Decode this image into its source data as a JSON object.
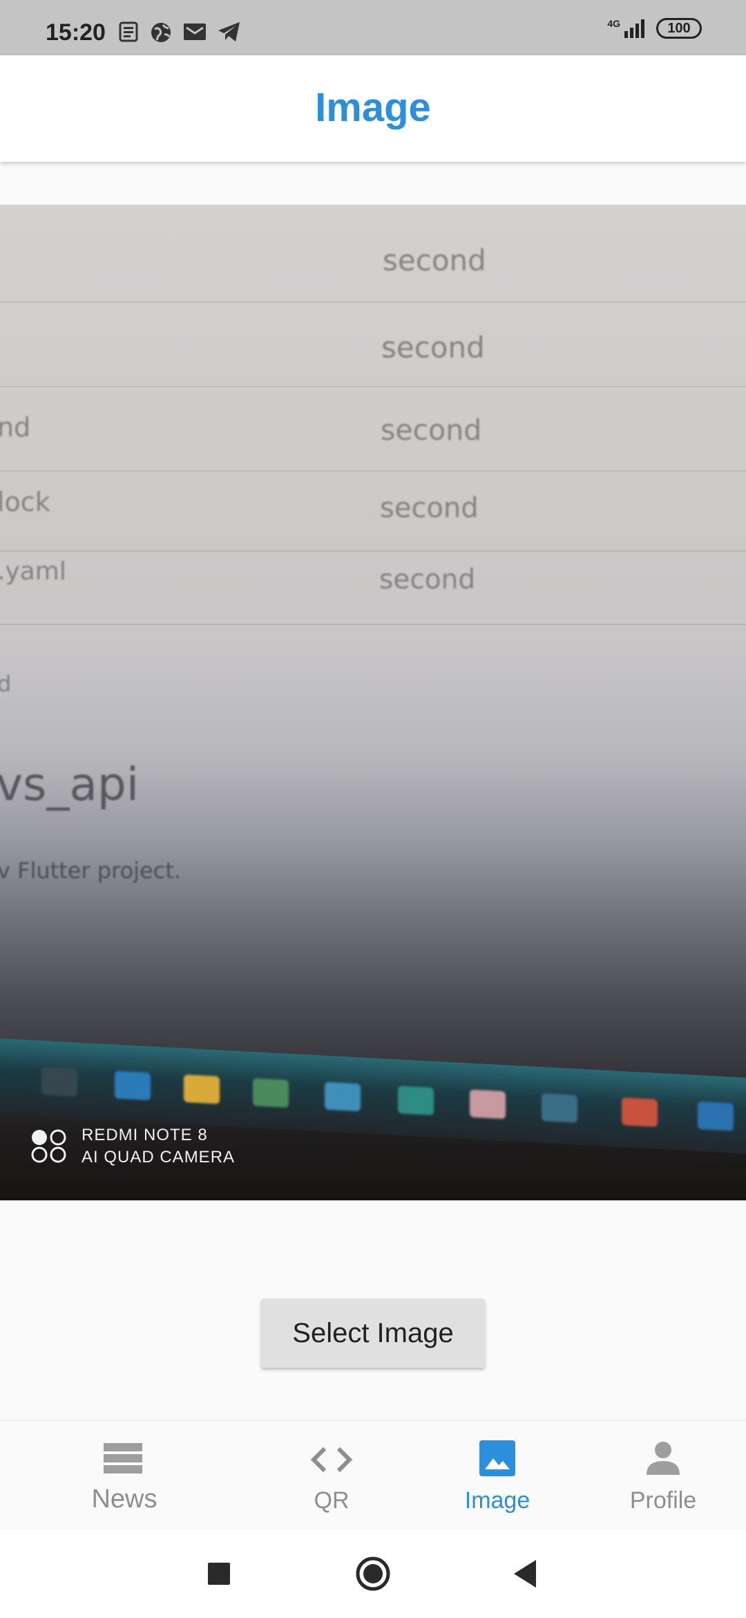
{
  "status_bar": {
    "time": "15:20",
    "network": "4G",
    "battery": "100",
    "notification_icons": [
      "news-icon",
      "globe-icon",
      "mail-icon",
      "telegram-icon"
    ]
  },
  "app_bar": {
    "title": "Image"
  },
  "photo": {
    "text_rows": [
      "second",
      "second",
      "second",
      "second",
      "second"
    ],
    "left_fragments": [
      "nd",
      "lock",
      ".yaml",
      "d"
    ],
    "heading_fragment": "vs_api",
    "desc_fragment": "v Flutter project.",
    "watermark_line1": "REDMI NOTE 8",
    "watermark_line2": "AI QUAD CAMERA"
  },
  "select_button": {
    "label": "Select Image"
  },
  "bottom_nav": {
    "items": [
      {
        "label": "News",
        "icon": "news-icon",
        "active": false
      },
      {
        "label": "QR",
        "icon": "code-icon",
        "active": false
      },
      {
        "label": "Image",
        "icon": "image-icon",
        "active": true
      },
      {
        "label": "Profile",
        "icon": "person-icon",
        "active": false
      }
    ]
  },
  "system_nav": {
    "buttons": [
      "recents",
      "home",
      "back"
    ]
  },
  "colors": {
    "accent": "#2d8fdb",
    "inactive": "#8e8e8e",
    "status_bar": "#c4c4c4"
  }
}
